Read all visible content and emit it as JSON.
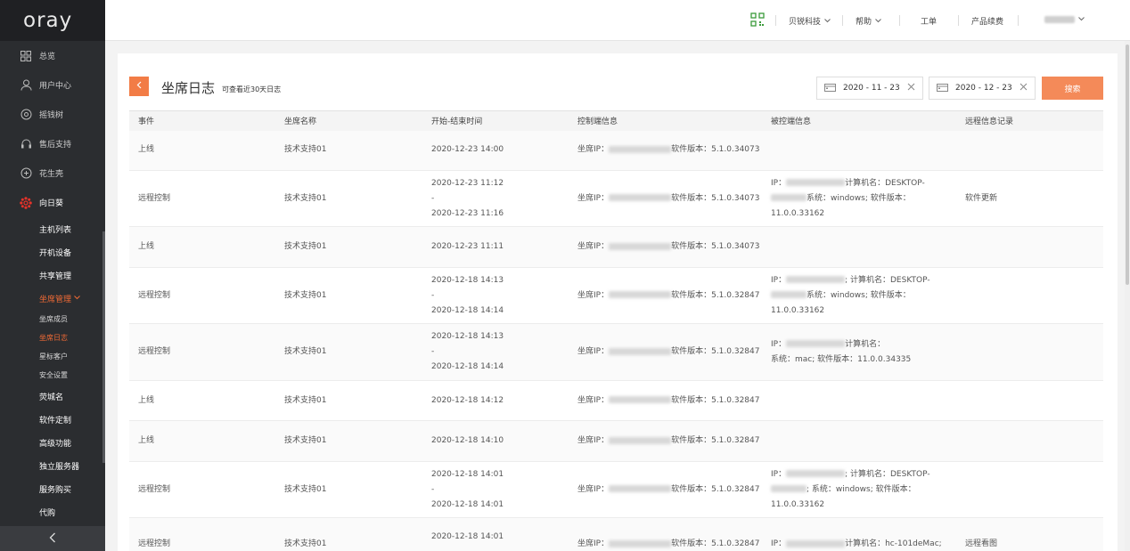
{
  "brand": {
    "logo_text": "oray"
  },
  "sidebar": {
    "items": [
      {
        "label": "总览",
        "icon": "grid-icon"
      },
      {
        "label": "用户中心",
        "icon": "user-icon"
      },
      {
        "label": "摇钱树",
        "icon": "coin-icon"
      },
      {
        "label": "售后支持",
        "icon": "headset-icon"
      },
      {
        "label": "花生壳",
        "icon": "peanut-icon"
      },
      {
        "label": "向日葵",
        "icon": "sunflower-icon"
      }
    ],
    "sub_items": [
      "主机列表",
      "开机设备",
      "共享管理"
    ],
    "open_group": "坐席管理",
    "group_children": [
      "坐席成员",
      "坐席日志",
      "星标客户",
      "安全设置"
    ],
    "after_items": [
      "荧城名",
      "软件定制",
      "高级功能",
      "独立服务器",
      "服务购买",
      "代购"
    ]
  },
  "header": {
    "company": "贝锐科技",
    "help": "帮助",
    "ticket": "工单",
    "renew": "产品续费"
  },
  "page": {
    "title": "坐席日志",
    "subtitle": "可查看近30天日志",
    "date_start": "2020 - 11 - 23",
    "date_end": "2020 - 12 - 23",
    "search_label": "搜索"
  },
  "table": {
    "headers": [
      "事件",
      "坐席名称",
      "开始-结束时间",
      "控制端信息",
      "被控端信息",
      "远程信息记录"
    ],
    "rows": [
      {
        "event": "上线",
        "agent": "技术支持01",
        "time": [
          "2020-12-23 14:00"
        ],
        "ctrl_prefix": "坐席IP：",
        "ctrl_ver": "软件版本：5.1.0.34073",
        "target": [],
        "record": ""
      },
      {
        "event": "远程控制",
        "agent": "技术支持01",
        "time": [
          "2020-12-23 11:12",
          "-",
          "2020-12-23 11:16"
        ],
        "ctrl_prefix": "坐席IP：",
        "ctrl_ver": "软件版本：5.1.0.34073",
        "target": [
          "IP：",
          "计算机名：DESKTOP-",
          "系统：windows; 软件版本：",
          "11.0.0.33162"
        ],
        "record": "软件更新"
      },
      {
        "event": "上线",
        "agent": "技术支持01",
        "time": [
          "2020-12-23 11:11"
        ],
        "ctrl_prefix": "坐席IP：",
        "ctrl_ver": "软件版本：5.1.0.34073",
        "target": [],
        "record": ""
      },
      {
        "event": "远程控制",
        "agent": "技术支持01",
        "time": [
          "2020-12-18 14:13",
          "-",
          "2020-12-18 14:14"
        ],
        "ctrl_prefix": "坐席IP：",
        "ctrl_ver": "软件版本：5.1.0.32847",
        "target": [
          "IP：",
          "; 计算机名：DESKTOP-",
          "系统：windows; 软件版本：",
          "11.0.0.33162"
        ],
        "record": ""
      },
      {
        "event": "远程控制",
        "agent": "技术支持01",
        "time": [
          "2020-12-18 14:13",
          "-",
          "2020-12-18 14:14"
        ],
        "ctrl_prefix": "坐席IP：",
        "ctrl_ver": "软件版本：5.1.0.32847",
        "target": [
          "IP：",
          "计算机名：",
          "系统：mac; 软件版本：11.0.0.34335",
          ""
        ],
        "record": ""
      },
      {
        "event": "上线",
        "agent": "技术支持01",
        "time": [
          "2020-12-18 14:12"
        ],
        "ctrl_prefix": "坐席IP：",
        "ctrl_ver": "软件版本：5.1.0.32847",
        "target": [],
        "record": ""
      },
      {
        "event": "上线",
        "agent": "技术支持01",
        "time": [
          "2020-12-18 14:10"
        ],
        "ctrl_prefix": "坐席IP：",
        "ctrl_ver": "软件版本：5.1.0.32847",
        "target": [],
        "record": ""
      },
      {
        "event": "远程控制",
        "agent": "技术支持01",
        "time": [
          "2020-12-18 14:01",
          "-",
          "2020-12-18 14:01"
        ],
        "ctrl_prefix": "坐席IP：",
        "ctrl_ver": "软件版本：5.1.0.32847",
        "target": [
          "IP：",
          "; 计算机名：DESKTOP-",
          "; 系统：windows; 软件版本：",
          "11.0.0.33162"
        ],
        "record": ""
      },
      {
        "event": "远程控制",
        "agent": "技术支持01",
        "time": [
          "2020-12-18 14:01",
          "-"
        ],
        "ctrl_prefix": "坐席IP：",
        "ctrl_ver": "软件版本：5.1.0.32847",
        "target": [
          "IP：",
          "计算机名：hc-101deMac;"
        ],
        "record": "远程看图"
      }
    ]
  },
  "colors": {
    "accent": "#f27c46",
    "sidebar_bg": "#2b2d30"
  }
}
